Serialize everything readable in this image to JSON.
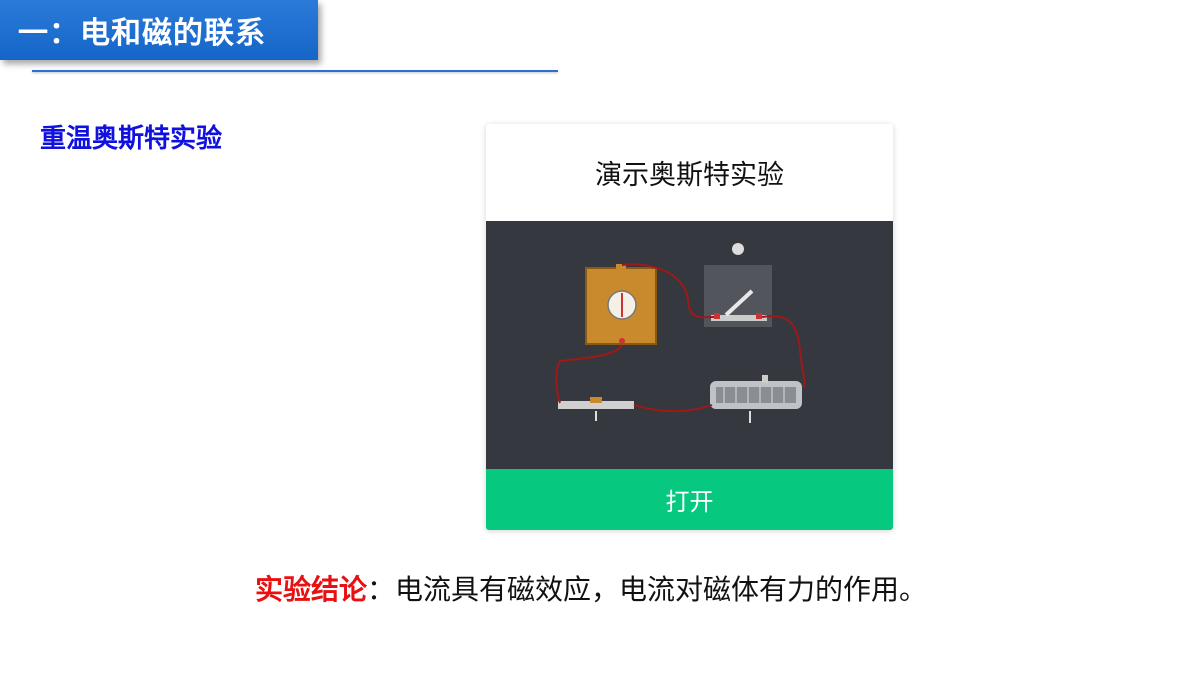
{
  "header": {
    "title": "一：电和磁的联系"
  },
  "section": {
    "subtitle": "重温奥斯特实验"
  },
  "demo_card": {
    "title": "演示奥斯特实验",
    "button_label": "打开",
    "colors": {
      "image_bg": "#35383e",
      "button_bg": "#06c97f"
    }
  },
  "conclusion": {
    "label": "实验结论",
    "separator": "：",
    "text": "电流具有磁效应，电流对磁体有力的作用。"
  },
  "colors": {
    "banner": "#1565c8",
    "subtitle": "#1010e0",
    "conclusion_label": "#e81010"
  }
}
